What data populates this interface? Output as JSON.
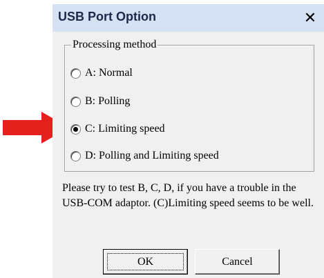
{
  "dialog": {
    "title": "USB Port Option",
    "close_symbol": "✕"
  },
  "group": {
    "label": "Processing method",
    "options": [
      {
        "label": "A: Normal",
        "checked": false
      },
      {
        "label": "B: Polling",
        "checked": false
      },
      {
        "label": "C: Limiting speed",
        "checked": true
      },
      {
        "label": "D: Polling and Limiting speed",
        "checked": false
      }
    ]
  },
  "note": "Please try to test B, C, D, if you have a trouble in the USB-COM adaptor. (C)Limiting speed seems to be well.",
  "buttons": {
    "ok": "OK",
    "cancel": "Cancel"
  },
  "annotation": {
    "arrow_color": "#e5211d",
    "arrow_icon": "right-arrow-icon"
  }
}
